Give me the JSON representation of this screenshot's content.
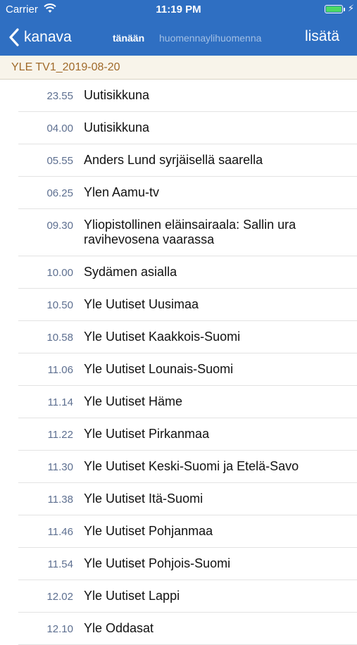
{
  "status_bar": {
    "carrier": "Carrier",
    "time": "11:19 PM",
    "battery_color": "#4cd964"
  },
  "nav": {
    "back_label": "kanava",
    "more_label": "lisätä",
    "tabs": [
      {
        "label": "tänään",
        "active": true
      },
      {
        "label": "huomenna",
        "active": false
      },
      {
        "label": "ylihuomenna",
        "active": false
      }
    ]
  },
  "channel": {
    "title": "YLE TV1_2019-08-20"
  },
  "programs": [
    {
      "time": "23.55",
      "title": "Uutisikkuna"
    },
    {
      "time": "04.00",
      "title": "Uutisikkuna"
    },
    {
      "time": "05.55",
      "title": "Anders Lund syrjäisellä saarella"
    },
    {
      "time": "06.25",
      "title": "Ylen Aamu-tv"
    },
    {
      "time": "09.30",
      "title": "Yliopistollinen eläinsairaala: Sallin ura ravihevosena vaarassa"
    },
    {
      "time": "10.00",
      "title": "Sydämen asialla"
    },
    {
      "time": "10.50",
      "title": "Yle Uutiset Uusimaa"
    },
    {
      "time": "10.58",
      "title": "Yle Uutiset Kaakkois-Suomi"
    },
    {
      "time": "11.06",
      "title": "Yle Uutiset Lounais-Suomi"
    },
    {
      "time": "11.14",
      "title": "Yle Uutiset Häme"
    },
    {
      "time": "11.22",
      "title": "Yle Uutiset Pirkanmaa"
    },
    {
      "time": "11.30",
      "title": "Yle Uutiset Keski-Suomi ja Etelä-Savo"
    },
    {
      "time": "11.38",
      "title": "Yle Uutiset Itä-Suomi"
    },
    {
      "time": "11.46",
      "title": "Yle Uutiset Pohjanmaa"
    },
    {
      "time": "11.54",
      "title": "Yle Uutiset Pohjois-Suomi"
    },
    {
      "time": "12.02",
      "title": "Yle Uutiset Lappi"
    },
    {
      "time": "12.10",
      "title": "Yle Oddasat"
    }
  ],
  "colors": {
    "header": "#2f6fc2",
    "channel_bar": "#f8f4ea",
    "channel_text": "#a06a2a",
    "time_text": "#5d6f90"
  }
}
